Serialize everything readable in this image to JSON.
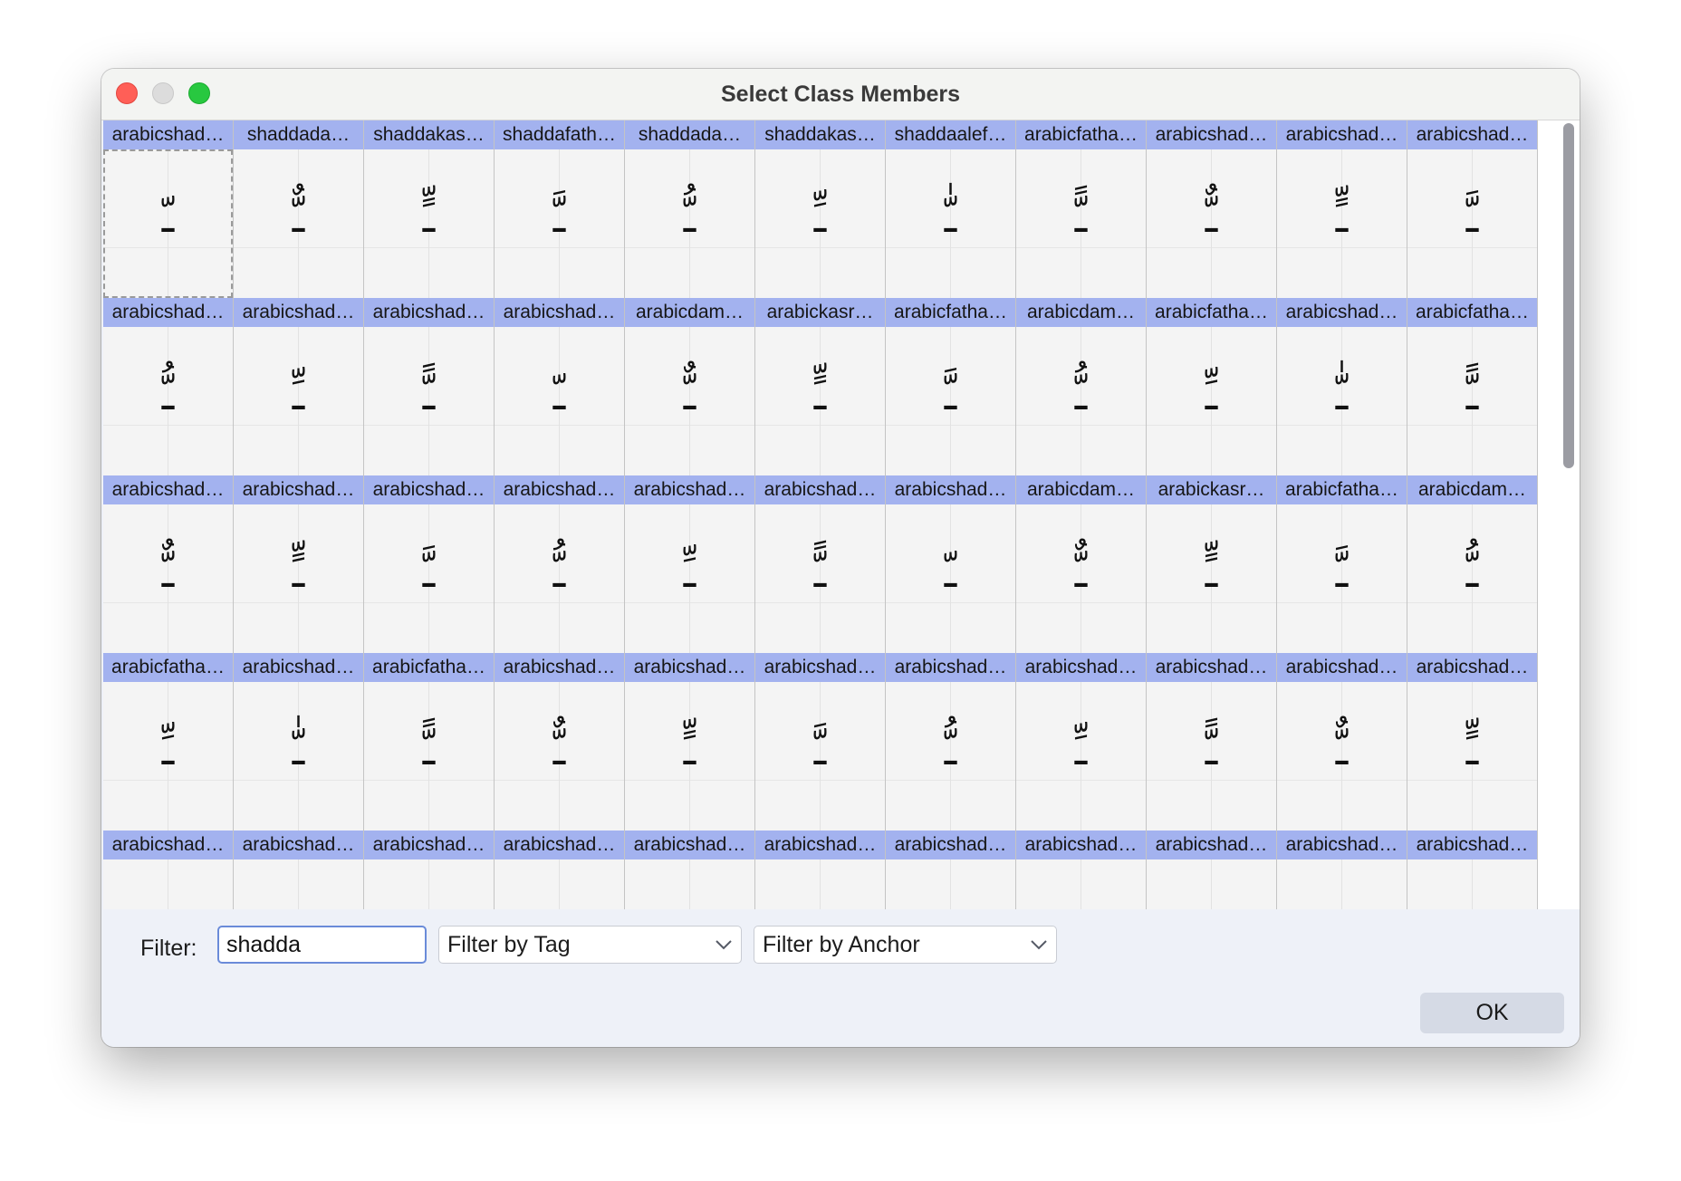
{
  "window": {
    "title": "Select Class Members",
    "traffic_lights": {
      "close_color": "#ff5f57",
      "minimize_color": "#dcdcdc",
      "zoom_color": "#28c840"
    }
  },
  "colors": {
    "label_strip": "#a3b2ef",
    "cell_background": "#f4f4f4",
    "input_focus_border": "#6a8bd9",
    "panel_background": "#eef1f8"
  },
  "grid": {
    "rows": [
      [
        {
          "label": "arabicshad…",
          "glyph": "ـّ"
        },
        {
          "label": "shaddada…",
          "glyph": "ـٌّ"
        },
        {
          "label": "shaddakas…",
          "glyph": "ـٍّ"
        },
        {
          "label": "shaddafath…",
          "glyph": "ـَّ"
        },
        {
          "label": "shaddada…",
          "glyph": "ـُّ"
        },
        {
          "label": "shaddakas…",
          "glyph": "ـِّ"
        },
        {
          "label": "shaddaalef…",
          "glyph": "ـّٰ"
        },
        {
          "label": "arabicfatha…",
          "glyph": "ـًّ"
        },
        {
          "label": "arabicshad…",
          "glyph": "ـٌّ"
        },
        {
          "label": "arabicshad…",
          "glyph": "ـٍّ"
        },
        {
          "label": "arabicshad…",
          "glyph": "ـَّ"
        }
      ],
      [
        {
          "label": "arabicshad…",
          "glyph": "ـُّ"
        },
        {
          "label": "arabicshad…",
          "glyph": "ـِّ"
        },
        {
          "label": "arabicshad…",
          "glyph": "ـًّ"
        },
        {
          "label": "arabicshad…",
          "glyph": "ـّ"
        },
        {
          "label": "arabicdam…",
          "glyph": "ـٌّ"
        },
        {
          "label": "arabickasr…",
          "glyph": "ـٍّ"
        },
        {
          "label": "arabicfatha…",
          "glyph": "ـَّ"
        },
        {
          "label": "arabicdam…",
          "glyph": "ـُّ"
        },
        {
          "label": "arabicfatha…",
          "glyph": "ـِّ"
        },
        {
          "label": "arabicshad…",
          "glyph": "ـّٰ"
        },
        {
          "label": "arabicfatha…",
          "glyph": "ـًّ"
        }
      ],
      [
        {
          "label": "arabicshad…",
          "glyph": "ـٌّ"
        },
        {
          "label": "arabicshad…",
          "glyph": "ـٍّ"
        },
        {
          "label": "arabicshad…",
          "glyph": "ـَّ"
        },
        {
          "label": "arabicshad…",
          "glyph": "ـُّ"
        },
        {
          "label": "arabicshad…",
          "glyph": "ـِّ"
        },
        {
          "label": "arabicshad…",
          "glyph": "ـًّ"
        },
        {
          "label": "arabicshad…",
          "glyph": "ـّ"
        },
        {
          "label": "arabicdam…",
          "glyph": "ـٌّ"
        },
        {
          "label": "arabickasr…",
          "glyph": "ـٍّ"
        },
        {
          "label": "arabicfatha…",
          "glyph": "ـَّ"
        },
        {
          "label": "arabicdam…",
          "glyph": "ـُّ"
        }
      ],
      [
        {
          "label": "arabicfatha…",
          "glyph": "ـِّ"
        },
        {
          "label": "arabicshad…",
          "glyph": "ـّٰ"
        },
        {
          "label": "arabicfatha…",
          "glyph": "ـًّ"
        },
        {
          "label": "arabicshad…",
          "glyph": "ـٌّ"
        },
        {
          "label": "arabicshad…",
          "glyph": "ـٍّ"
        },
        {
          "label": "arabicshad…",
          "glyph": "ـَّ"
        },
        {
          "label": "arabicshad…",
          "glyph": "ـُّ"
        },
        {
          "label": "arabicshad…",
          "glyph": "ـِّ"
        },
        {
          "label": "arabicshad…",
          "glyph": "ـًّ"
        },
        {
          "label": "arabicshad…",
          "glyph": "ـٌّ"
        },
        {
          "label": "arabicshad…",
          "glyph": "ـٍّ"
        }
      ],
      [
        {
          "label": "arabicshad…"
        },
        {
          "label": "arabicshad…"
        },
        {
          "label": "arabicshad…"
        },
        {
          "label": "arabicshad…"
        },
        {
          "label": "arabicshad…"
        },
        {
          "label": "arabicshad…"
        },
        {
          "label": "arabicshad…"
        },
        {
          "label": "arabicshad…"
        },
        {
          "label": "arabicshad…"
        },
        {
          "label": "arabicshad…"
        },
        {
          "label": "arabicshad…"
        }
      ]
    ]
  },
  "filter": {
    "label": "Filter:",
    "value": "shadda"
  },
  "dropdowns": {
    "tag": {
      "label": "Filter by Tag",
      "icon": "chevron-down-icon"
    },
    "anchor": {
      "label": "Filter by Anchor",
      "icon": "chevron-down-icon"
    }
  },
  "actions": {
    "ok_label": "OK"
  }
}
